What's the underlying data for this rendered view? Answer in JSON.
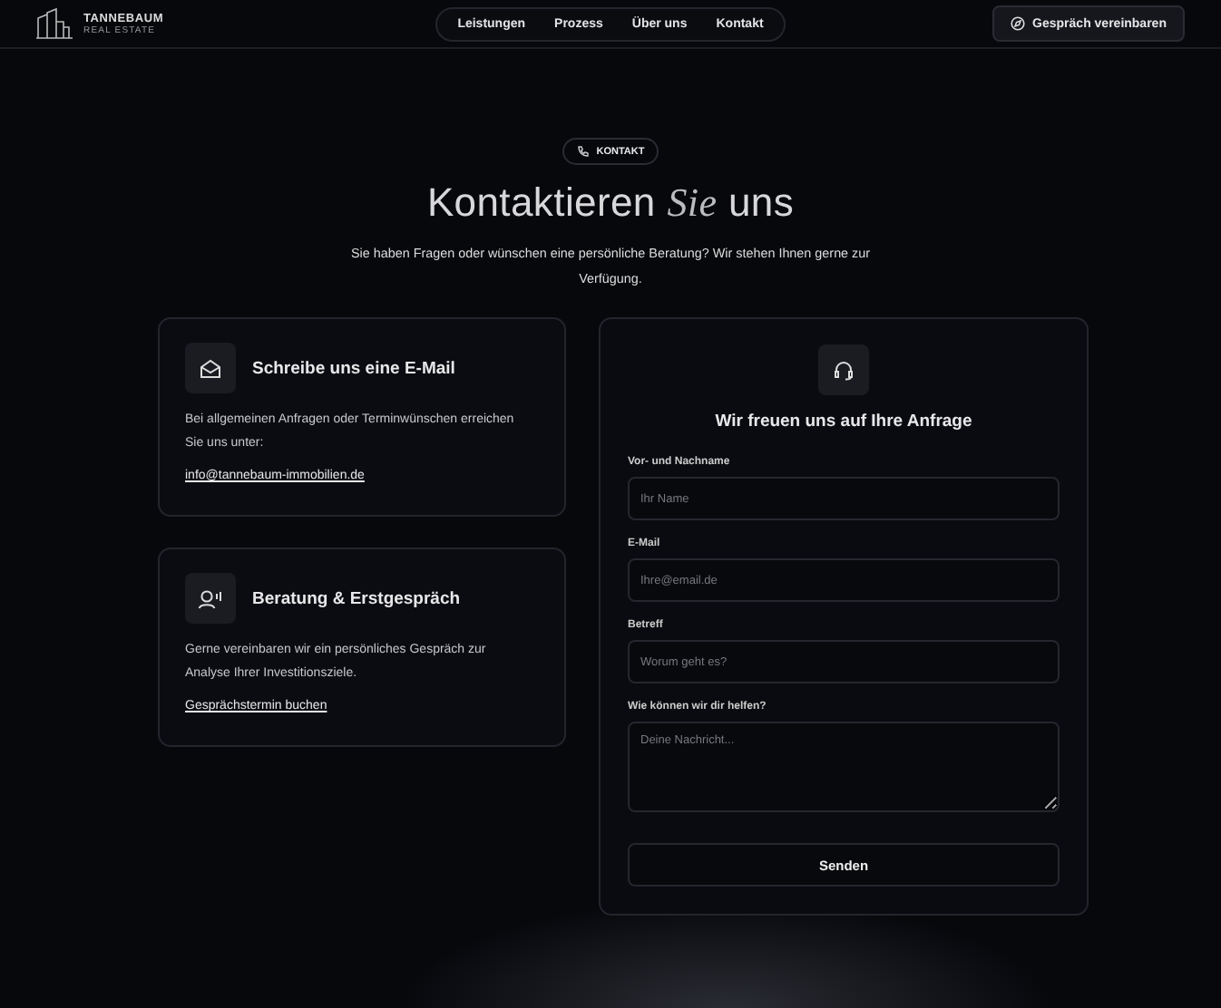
{
  "header": {
    "logo": {
      "name": "TANNEBAUM",
      "tagline": "REAL ESTATE"
    },
    "nav": [
      {
        "label": "Leistungen"
      },
      {
        "label": "Prozess"
      },
      {
        "label": "Über uns"
      },
      {
        "label": "Kontakt"
      }
    ],
    "cta": "Gespräch vereinbaren"
  },
  "hero": {
    "badge": "KONTAKT",
    "title_before": "Kontaktieren",
    "title_accent": "Sie",
    "title_after": "uns",
    "subtitle": "Sie haben Fragen oder wünschen eine persönliche Beratung? Wir stehen Ihnen gerne zur Verfügung."
  },
  "cards": [
    {
      "kind": "mail",
      "title": "Schreibe uns eine E-Mail",
      "text": "Bei allgemeinen Anfragen oder Terminwünschen erreichen Sie uns unter:",
      "link": "info@tannebaum-immobilien.de"
    },
    {
      "kind": "consult",
      "title": "Beratung & Erstgespräch",
      "text": "Gerne vereinbaren wir ein persönliches Gespräch zur Analyse Ihrer Investitionsziele.",
      "link": "Gesprächstermin buchen"
    }
  ],
  "form": {
    "title": "Wir freuen uns auf Ihre Anfrage",
    "fields": [
      {
        "kind": "input",
        "label": "Vor- und Nachname",
        "placeholder": "Ihr Name"
      },
      {
        "kind": "input",
        "label": "E-Mail",
        "placeholder": "Ihre@email.de"
      },
      {
        "kind": "input",
        "label": "Betreff",
        "placeholder": "Worum geht es?"
      },
      {
        "kind": "textarea",
        "label": "Wie können wir dir helfen?",
        "placeholder": "Deine Nachricht..."
      }
    ],
    "submit": "Senden"
  }
}
